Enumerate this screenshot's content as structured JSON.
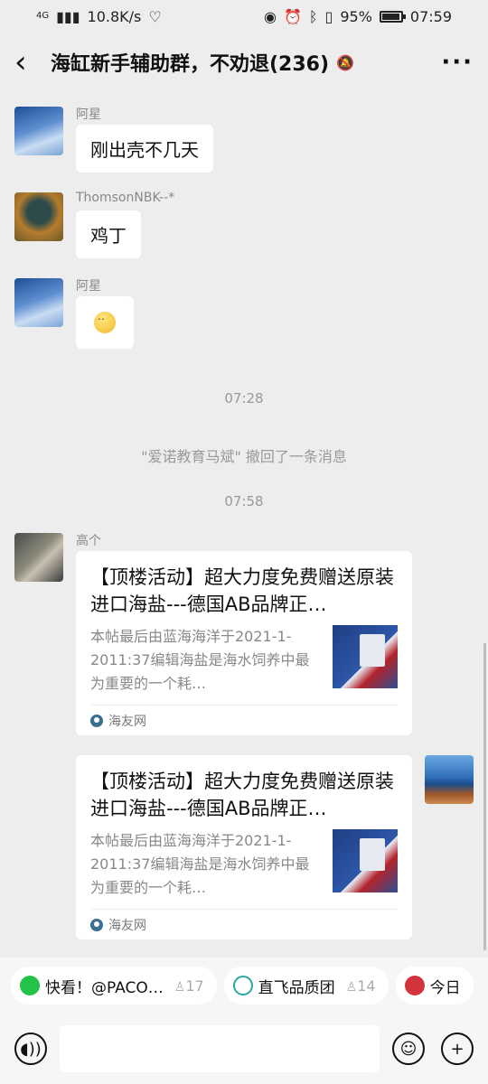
{
  "status_bar": {
    "network": "4G",
    "speed": "10.8K/s",
    "battery": "95%",
    "battery_level": 0.95,
    "time": "07:59"
  },
  "header": {
    "title": "海缸新手辅助群，不劝退(236)"
  },
  "messages": [
    {
      "sender": "阿星",
      "text": "刚出壳不几天"
    },
    {
      "sender": "ThomsonNBK--*",
      "text": "鸡丁"
    },
    {
      "sender": "阿星",
      "type": "emoji"
    }
  ],
  "timestamps": [
    "07:28",
    "07:58"
  ],
  "system_notice": "\"爱诺教育马斌\" 撤回了一条消息",
  "cards": [
    {
      "sender": "高个",
      "title": "【顶楼活动】超大力度免费赠送原装进口海盐---德国AB品牌正…",
      "desc": "本帖最后由蓝海海洋于2021-1-2011:37编辑海盐是海水饲养中最为重要的一个耗…",
      "source": "海友网"
    },
    {
      "sender": "self",
      "title": "【顶楼活动】超大力度免费赠送原装进口海盐---德国AB品牌正…",
      "desc": "本帖最后由蓝海海洋于2021-1-2011:37编辑海盐是海水饲养中最为重要的一个耗…",
      "source": "海友网"
    }
  ],
  "quick_chips": [
    {
      "label": "快看！@PACO…",
      "count": "17"
    },
    {
      "label": "直飞品质团",
      "count": "14"
    },
    {
      "label": "今日"
    }
  ]
}
